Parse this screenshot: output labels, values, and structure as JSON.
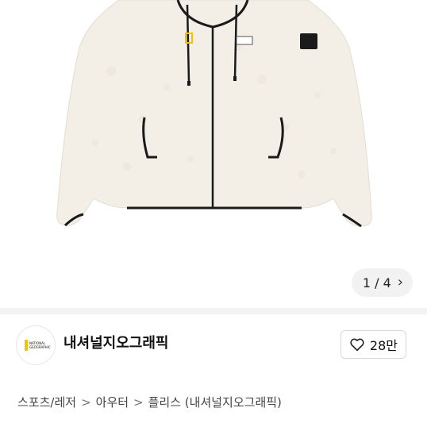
{
  "gallery": {
    "counter": "1 / 4",
    "next_icon": "chevron-right-icon",
    "jacket_color": "#f3efe6",
    "trim_color": "#1a1a1a"
  },
  "brand": {
    "name": "내셔널지오그래픽",
    "logo_text": "NATIONAL GEOGRAPHIC",
    "logo_accent": "#f0c400",
    "likes": "28만",
    "like_icon": "heart-icon"
  },
  "breadcrumb": {
    "items": [
      "스포츠/레저",
      "아우터",
      "플리스 (내셔널지오그래픽)"
    ],
    "separator": ">"
  }
}
